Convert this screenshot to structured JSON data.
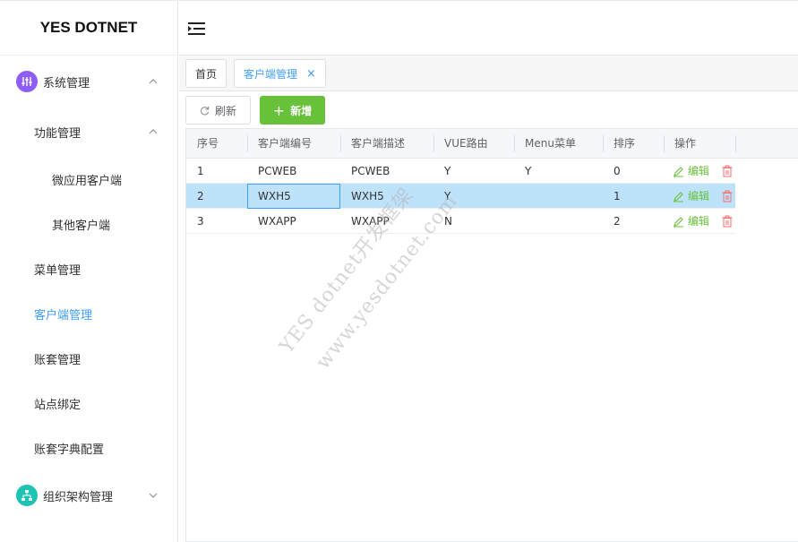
{
  "logo": "YES DOTNET",
  "sidebar": {
    "items": [
      {
        "label": "系统管理",
        "icon": "sliders-icon",
        "icon_color": "#8e5cf7",
        "expanded": true
      },
      {
        "label": "功能管理",
        "expanded": true
      },
      {
        "label": "微应用客户端"
      },
      {
        "label": "其他客户端"
      },
      {
        "label": "菜单管理"
      },
      {
        "label": "客户端管理",
        "active": true
      },
      {
        "label": "账套管理"
      },
      {
        "label": "站点绑定"
      },
      {
        "label": "账套字典配置"
      },
      {
        "label": "组织架构管理",
        "icon": "org-chart-icon",
        "icon_color": "#1ec4b3",
        "expanded": false
      }
    ]
  },
  "tabs": [
    {
      "label": "首页"
    },
    {
      "label": "客户端管理",
      "active": true,
      "close": "×"
    }
  ],
  "toolbar": {
    "refresh_label": "刷新",
    "add_label": "新增",
    "add_icon": "+"
  },
  "table": {
    "columns": [
      "序号",
      "客户端编号",
      "客户端描述",
      "VUE路由",
      "Menu菜单",
      "排序",
      "操作"
    ],
    "rows": [
      {
        "no": "1",
        "code": "PCWEB",
        "desc": "PCWEB",
        "vue": "Y",
        "menu": "Y",
        "sort": "0",
        "edit": "编辑"
      },
      {
        "no": "2",
        "code": "WXH5",
        "desc": "WXH5",
        "vue": "Y",
        "menu": "",
        "sort": "1",
        "edit": "编辑",
        "selected": true
      },
      {
        "no": "3",
        "code": "WXAPP",
        "desc": "WXAPP",
        "vue": "N",
        "menu": "",
        "sort": "2",
        "edit": "编辑"
      }
    ]
  },
  "watermark": {
    "line1": "YES dotnet开发框架",
    "line2": "www.yesdotnet.com"
  },
  "colors": {
    "accent": "#409eff",
    "add_button": "#67c23a",
    "selected_row": "#bfe2fb",
    "delete": "#f56c6c"
  }
}
